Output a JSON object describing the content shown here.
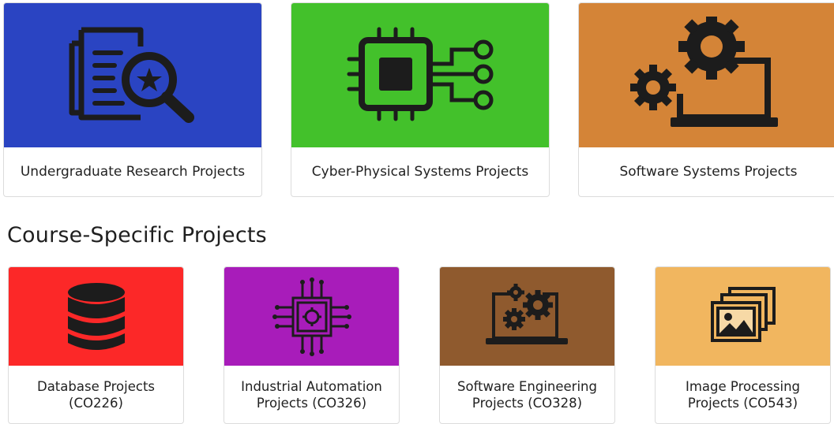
{
  "featured": [
    {
      "title": "Undergraduate Research Projects",
      "color": "#2a44c2",
      "icon": "document-search-star-icon"
    },
    {
      "title": "Cyber-Physical Systems Projects",
      "color": "#43c12b",
      "icon": "microchip-circuit-icon"
    },
    {
      "title": "Software Systems Projects",
      "color": "#d48437",
      "icon": "gears-laptop-icon"
    }
  ],
  "section": {
    "title": "Course-Specific Projects"
  },
  "courses": [
    {
      "title": "Database Projects (CO226)",
      "color": "#fc2828",
      "icon": "database-icon"
    },
    {
      "title": "Industrial Automation Projects (CO326)",
      "color": "#a81cba",
      "icon": "automation-chip-icon"
    },
    {
      "title": "Software Engineering Projects (CO328)",
      "color": "#8f5a2e",
      "icon": "gears-laptop-icon"
    },
    {
      "title": "Image Processing Projects (CO543)",
      "color": "#f1b65f",
      "icon": "image-gallery-icon"
    }
  ]
}
